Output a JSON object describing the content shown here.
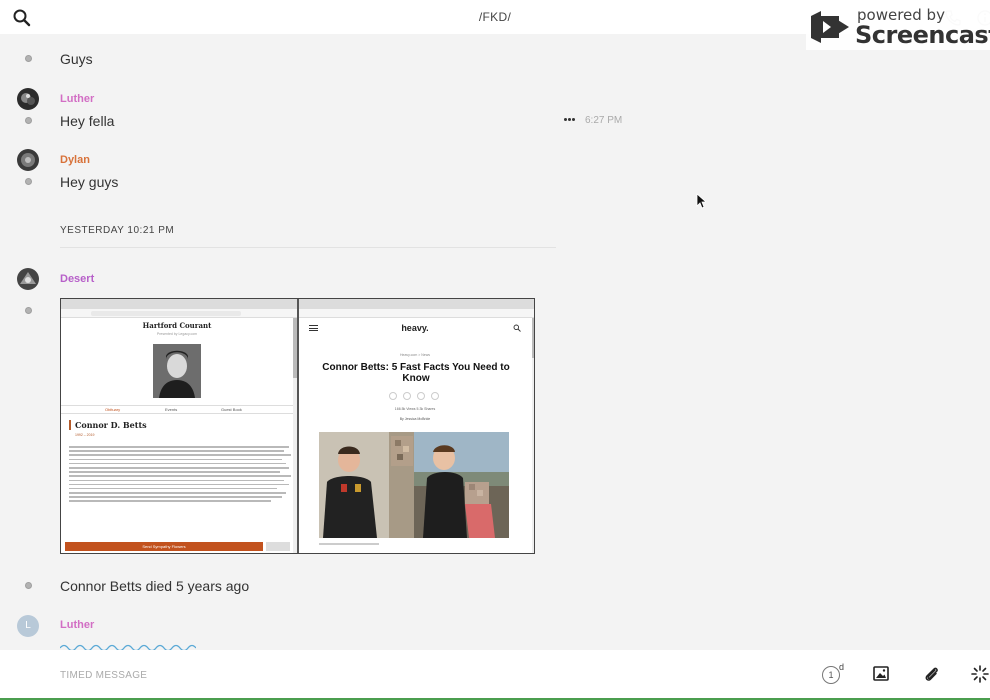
{
  "header": {
    "title": "/FKD/"
  },
  "watermark": {
    "line1": "powered by",
    "line2": "Screencastify"
  },
  "messages": [
    {
      "text": "Guys"
    },
    {
      "sender": "Luther",
      "sender_color": "#d26ec4",
      "text": "Hey fella",
      "time": "6:27 PM"
    },
    {
      "sender": "Dylan",
      "sender_color": "#d8723a",
      "text": "Hey guys"
    },
    {
      "sender": "Desert",
      "sender_color": "#b760c9"
    },
    {
      "text": "Connor Betts died 5 years ago"
    },
    {
      "sender": "Luther",
      "sender_color": "#d26ec4",
      "avatar_letter": "L"
    }
  ],
  "divider": {
    "label": "YESTERDAY 10:21 PM"
  },
  "attachment": {
    "left": {
      "masthead": "Hartford Courant",
      "sub": "Presented by Legacy.com",
      "nav": [
        "Obituary",
        "Events",
        "Guest Book"
      ],
      "name": "Connor D. Betts",
      "years": "1992 – 2019",
      "button": "Send Sympathy Flowers"
    },
    "right": {
      "logo": "heavy.",
      "crumb": "Heavy.com  >  News",
      "headline": "Connor Betts: 5 Fast Facts You Need to Know",
      "stats": "166.5k Views     5.3k Shares",
      "byline": "By Jessica McBride"
    }
  },
  "composer": {
    "placeholder": "TIMED MESSAGE",
    "timer_value": "1",
    "timer_unit": "d"
  },
  "colors": {
    "accent_green": "#4b9e4f",
    "obit_accent": "#c2521e"
  }
}
